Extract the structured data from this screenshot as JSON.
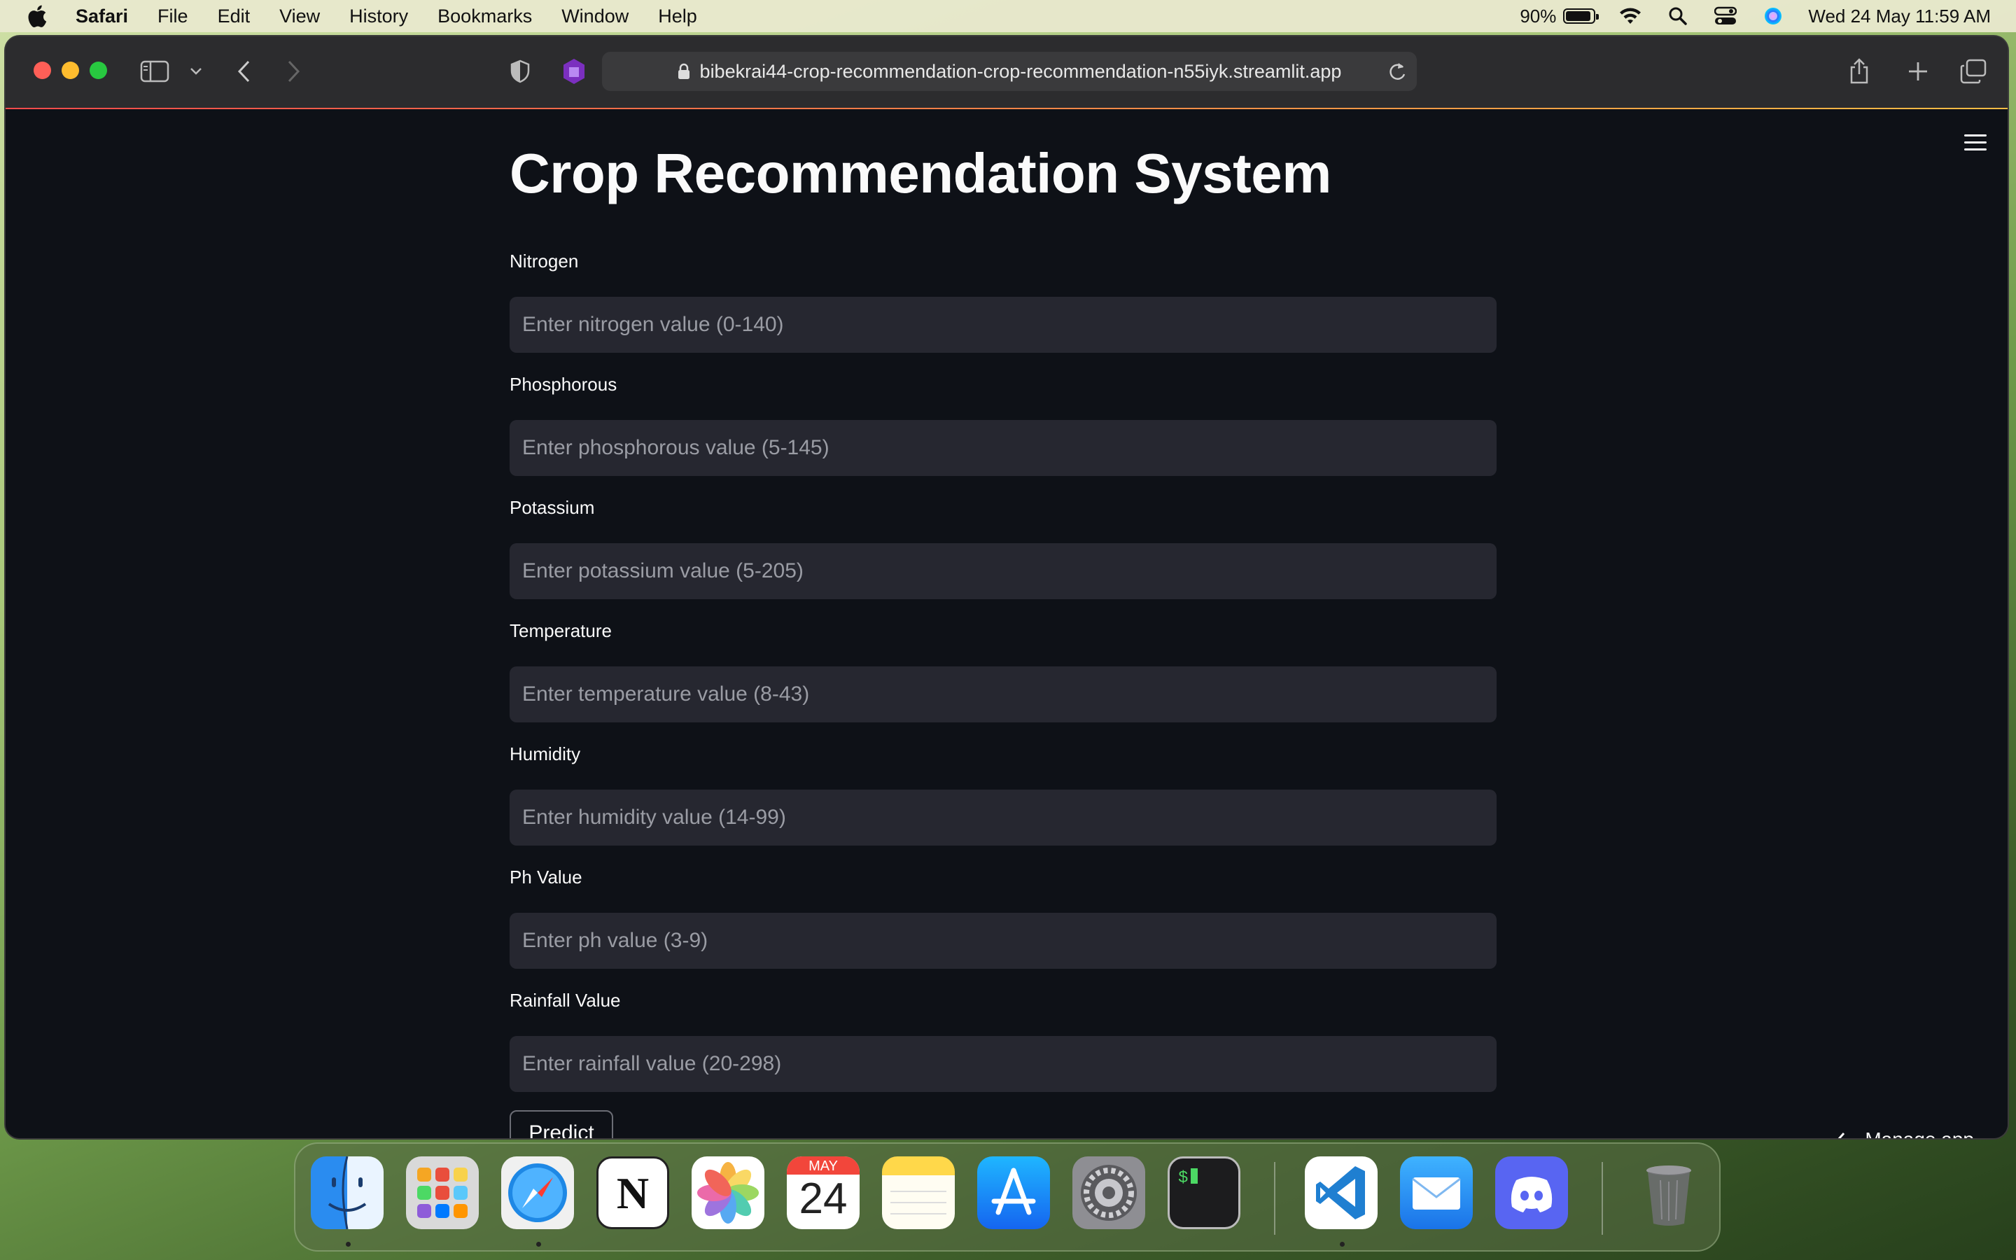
{
  "menubar": {
    "app_name": "Safari",
    "items": [
      "File",
      "Edit",
      "View",
      "History",
      "Bookmarks",
      "Window",
      "Help"
    ],
    "battery_percent": "90%",
    "battery_level": 0.9,
    "datetime": "Wed 24 May  11:59 AM"
  },
  "browser": {
    "url": "bibekrai44-crop-recommendation-crop-recommendation-n55iyk.streamlit.app"
  },
  "app": {
    "title": "Crop Recommendation System",
    "fields": [
      {
        "label": "Nitrogen",
        "placeholder": "Enter nitrogen value (0-140)"
      },
      {
        "label": "Phosphorous",
        "placeholder": "Enter phosphorous value (5-145)"
      },
      {
        "label": "Potassium",
        "placeholder": "Enter potassium value (5-205)"
      },
      {
        "label": "Temperature",
        "placeholder": "Enter temperature value (8-43)"
      },
      {
        "label": "Humidity",
        "placeholder": "Enter humidity value (14-99)"
      },
      {
        "label": "Ph Value",
        "placeholder": "Enter ph value (3-9)"
      },
      {
        "label": "Rainfall Value",
        "placeholder": "Enter rainfall value (20-298)"
      }
    ],
    "predict_label": "Predict",
    "manage_label": "Manage app"
  },
  "dock": {
    "calendar_month": "MAY",
    "calendar_day": "24",
    "apps": [
      "finder-icon",
      "launchpad-icon",
      "safari-icon",
      "notion-icon",
      "photos-icon",
      "calendar-icon",
      "notes-icon",
      "app-store-icon",
      "system-settings-icon",
      "terminal-icon",
      "vscode-icon",
      "mail-icon",
      "discord-icon",
      "trash-icon"
    ]
  },
  "colors": {
    "page_background": "#0e1117",
    "input_background": "#262730",
    "accent_red": "#ff4b4b"
  }
}
